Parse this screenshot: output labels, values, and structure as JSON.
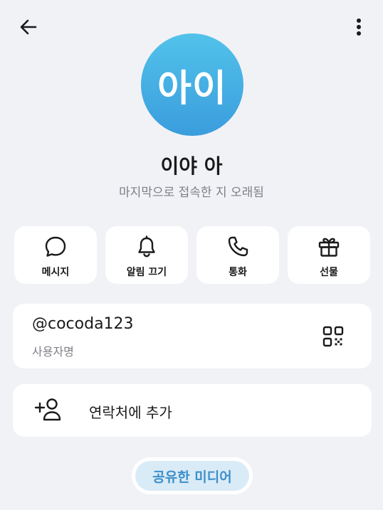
{
  "header": {
    "back_icon": "arrow-left-icon",
    "more_icon": "more-vertical-icon"
  },
  "profile": {
    "avatar_initials": "아이",
    "avatar_gradient": [
      "#52c2ea",
      "#3a9ddd"
    ],
    "name": "이야 아",
    "status": "마지막으로 접속한 지 오래됨"
  },
  "actions": [
    {
      "label": "메시지",
      "icon": "chat-bubble-icon"
    },
    {
      "label": "알림 끄기",
      "icon": "bell-icon"
    },
    {
      "label": "통화",
      "icon": "phone-icon"
    },
    {
      "label": "선물",
      "icon": "gift-icon"
    }
  ],
  "username": {
    "value": "@cocoda123",
    "caption": "사용자명",
    "icon": "qr-code-icon"
  },
  "add_contact": {
    "label": "연락처에 추가",
    "icon": "add-contact-icon"
  },
  "shared_media": {
    "label": "공유한 미디어"
  },
  "colors": {
    "background": "#f1f2f6",
    "card": "#ffffff",
    "accent": "#3d8fca",
    "accent_soft": "#d9ebf7",
    "secondary_text": "#7d7f86"
  }
}
